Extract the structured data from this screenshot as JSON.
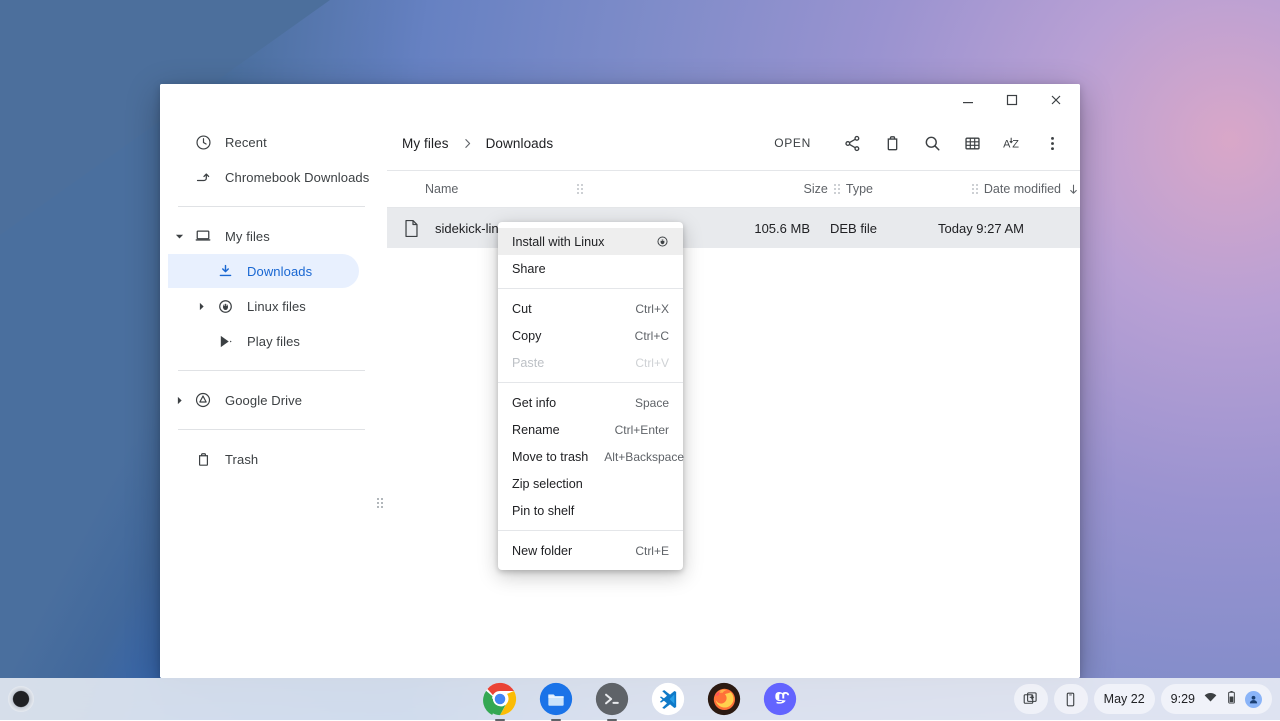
{
  "desktop": {
    "wallpaper_colors": {
      "blue": "#2f63b4",
      "steel_blue": "#4a6f9e",
      "cream_arc": "#faf8cd",
      "lavender": "#a894d1",
      "pink": "#d9a7c8"
    }
  },
  "window": {
    "controls": {
      "minimize": "minimize",
      "maximize": "maximize",
      "close": "close"
    }
  },
  "sidebar": {
    "groups": [
      {
        "items": [
          {
            "label": "Recent",
            "icon": "clock-icon",
            "selected": false,
            "twisty": "none",
            "indent": 0
          },
          {
            "label": "Chromebook Downloads",
            "icon": "arrow-forward-icon",
            "selected": false,
            "twisty": "none",
            "indent": 0
          }
        ]
      },
      {
        "items": [
          {
            "label": "My files",
            "icon": "laptop-icon",
            "selected": false,
            "twisty": "expanded",
            "indent": 0
          },
          {
            "label": "Downloads",
            "icon": "download-icon",
            "selected": true,
            "twisty": "none",
            "indent": 1
          },
          {
            "label": "Linux files",
            "icon": "linux-penguin-icon",
            "selected": false,
            "twisty": "collapsed",
            "indent": 1
          },
          {
            "label": "Play files",
            "icon": "play-store-icon",
            "selected": false,
            "twisty": "none",
            "indent": 1
          }
        ]
      },
      {
        "items": [
          {
            "label": "Google Drive",
            "icon": "google-drive-icon",
            "selected": false,
            "twisty": "collapsed",
            "indent": 0
          }
        ]
      },
      {
        "items": [
          {
            "label": "Trash",
            "icon": "trash-icon",
            "selected": false,
            "twisty": "none",
            "indent": 0
          }
        ]
      }
    ]
  },
  "toolbar": {
    "breadcrumb": [
      "My files",
      "Downloads"
    ],
    "open_label": "OPEN",
    "actions": [
      {
        "name": "share-icon",
        "title": "Share"
      },
      {
        "name": "delete-icon",
        "title": "Delete"
      },
      {
        "name": "search-icon",
        "title": "Search"
      },
      {
        "name": "grid-view-icon",
        "title": "Switch to grid view"
      },
      {
        "name": "sort-az-icon",
        "title": "Sort"
      },
      {
        "name": "more-vert-icon",
        "title": "More"
      }
    ]
  },
  "filelist": {
    "columns": [
      {
        "label": "Name",
        "key": "name"
      },
      {
        "label": "Size",
        "key": "size"
      },
      {
        "label": "Type",
        "key": "type"
      },
      {
        "label": "Date modified",
        "key": "date",
        "sorted": "descending"
      }
    ],
    "rows": [
      {
        "name": "sidekick-linux-release.deb",
        "size": "105.6 MB",
        "type": "DEB file",
        "date": "Today 9:27 AM",
        "selected": true,
        "icon": "generic-file-icon"
      }
    ]
  },
  "context_menu": {
    "sections": [
      [
        {
          "label": "Install with Linux",
          "accel": "",
          "disabled": false,
          "highlight": true,
          "icon": "linux-penguin-icon"
        },
        {
          "label": "Share",
          "accel": "",
          "disabled": false,
          "highlight": false,
          "icon": ""
        }
      ],
      [
        {
          "label": "Cut",
          "accel": "Ctrl+X",
          "disabled": false,
          "highlight": false,
          "icon": ""
        },
        {
          "label": "Copy",
          "accel": "Ctrl+C",
          "disabled": false,
          "highlight": false,
          "icon": ""
        },
        {
          "label": "Paste",
          "accel": "Ctrl+V",
          "disabled": true,
          "highlight": false,
          "icon": ""
        }
      ],
      [
        {
          "label": "Get info",
          "accel": "Space",
          "disabled": false,
          "highlight": false,
          "icon": ""
        },
        {
          "label": "Rename",
          "accel": "Ctrl+Enter",
          "disabled": false,
          "highlight": false,
          "icon": ""
        },
        {
          "label": "Move to trash",
          "accel": "Alt+Backspace",
          "disabled": false,
          "highlight": false,
          "icon": ""
        },
        {
          "label": "Zip selection",
          "accel": "",
          "disabled": false,
          "highlight": false,
          "icon": ""
        },
        {
          "label": "Pin to shelf",
          "accel": "",
          "disabled": false,
          "highlight": false,
          "icon": ""
        }
      ],
      [
        {
          "label": "New folder",
          "accel": "Ctrl+E",
          "disabled": false,
          "highlight": false,
          "icon": ""
        }
      ]
    ]
  },
  "shelf": {
    "launcher": "launcher-button",
    "apps": [
      {
        "name": "chrome-app-icon",
        "label": "Chrome",
        "running": true
      },
      {
        "name": "files-app-icon",
        "label": "Files",
        "running": true
      },
      {
        "name": "terminal-app-icon",
        "label": "Terminal",
        "running": true
      },
      {
        "name": "vscode-app-icon",
        "label": "Visual Studio Code",
        "running": false
      },
      {
        "name": "firefox-app-icon",
        "label": "Firefox",
        "running": false
      },
      {
        "name": "mastodon-app-icon",
        "label": "Mastodon",
        "running": false
      }
    ],
    "tray": {
      "screen_capture": "screen-capture-icon",
      "phone_hub": "phone-hub-icon",
      "date": "May 22",
      "time": "9:29",
      "network": "wifi-icon",
      "battery": "battery-icon",
      "avatar": "user-avatar"
    }
  }
}
